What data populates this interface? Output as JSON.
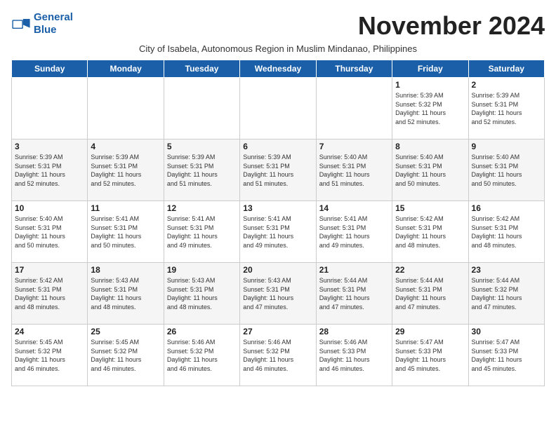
{
  "logo": {
    "line1": "General",
    "line2": "Blue"
  },
  "title": "November 2024",
  "subtitle": "City of Isabela, Autonomous Region in Muslim Mindanao, Philippines",
  "days_of_week": [
    "Sunday",
    "Monday",
    "Tuesday",
    "Wednesday",
    "Thursday",
    "Friday",
    "Saturday"
  ],
  "weeks": [
    [
      {
        "day": "",
        "detail": ""
      },
      {
        "day": "",
        "detail": ""
      },
      {
        "day": "",
        "detail": ""
      },
      {
        "day": "",
        "detail": ""
      },
      {
        "day": "",
        "detail": ""
      },
      {
        "day": "1",
        "detail": "Sunrise: 5:39 AM\nSunset: 5:32 PM\nDaylight: 11 hours\nand 52 minutes."
      },
      {
        "day": "2",
        "detail": "Sunrise: 5:39 AM\nSunset: 5:31 PM\nDaylight: 11 hours\nand 52 minutes."
      }
    ],
    [
      {
        "day": "3",
        "detail": "Sunrise: 5:39 AM\nSunset: 5:31 PM\nDaylight: 11 hours\nand 52 minutes."
      },
      {
        "day": "4",
        "detail": "Sunrise: 5:39 AM\nSunset: 5:31 PM\nDaylight: 11 hours\nand 52 minutes."
      },
      {
        "day": "5",
        "detail": "Sunrise: 5:39 AM\nSunset: 5:31 PM\nDaylight: 11 hours\nand 51 minutes."
      },
      {
        "day": "6",
        "detail": "Sunrise: 5:39 AM\nSunset: 5:31 PM\nDaylight: 11 hours\nand 51 minutes."
      },
      {
        "day": "7",
        "detail": "Sunrise: 5:40 AM\nSunset: 5:31 PM\nDaylight: 11 hours\nand 51 minutes."
      },
      {
        "day": "8",
        "detail": "Sunrise: 5:40 AM\nSunset: 5:31 PM\nDaylight: 11 hours\nand 50 minutes."
      },
      {
        "day": "9",
        "detail": "Sunrise: 5:40 AM\nSunset: 5:31 PM\nDaylight: 11 hours\nand 50 minutes."
      }
    ],
    [
      {
        "day": "10",
        "detail": "Sunrise: 5:40 AM\nSunset: 5:31 PM\nDaylight: 11 hours\nand 50 minutes."
      },
      {
        "day": "11",
        "detail": "Sunrise: 5:41 AM\nSunset: 5:31 PM\nDaylight: 11 hours\nand 50 minutes."
      },
      {
        "day": "12",
        "detail": "Sunrise: 5:41 AM\nSunset: 5:31 PM\nDaylight: 11 hours\nand 49 minutes."
      },
      {
        "day": "13",
        "detail": "Sunrise: 5:41 AM\nSunset: 5:31 PM\nDaylight: 11 hours\nand 49 minutes."
      },
      {
        "day": "14",
        "detail": "Sunrise: 5:41 AM\nSunset: 5:31 PM\nDaylight: 11 hours\nand 49 minutes."
      },
      {
        "day": "15",
        "detail": "Sunrise: 5:42 AM\nSunset: 5:31 PM\nDaylight: 11 hours\nand 48 minutes."
      },
      {
        "day": "16",
        "detail": "Sunrise: 5:42 AM\nSunset: 5:31 PM\nDaylight: 11 hours\nand 48 minutes."
      }
    ],
    [
      {
        "day": "17",
        "detail": "Sunrise: 5:42 AM\nSunset: 5:31 PM\nDaylight: 11 hours\nand 48 minutes."
      },
      {
        "day": "18",
        "detail": "Sunrise: 5:43 AM\nSunset: 5:31 PM\nDaylight: 11 hours\nand 48 minutes."
      },
      {
        "day": "19",
        "detail": "Sunrise: 5:43 AM\nSunset: 5:31 PM\nDaylight: 11 hours\nand 48 minutes."
      },
      {
        "day": "20",
        "detail": "Sunrise: 5:43 AM\nSunset: 5:31 PM\nDaylight: 11 hours\nand 47 minutes."
      },
      {
        "day": "21",
        "detail": "Sunrise: 5:44 AM\nSunset: 5:31 PM\nDaylight: 11 hours\nand 47 minutes."
      },
      {
        "day": "22",
        "detail": "Sunrise: 5:44 AM\nSunset: 5:31 PM\nDaylight: 11 hours\nand 47 minutes."
      },
      {
        "day": "23",
        "detail": "Sunrise: 5:44 AM\nSunset: 5:32 PM\nDaylight: 11 hours\nand 47 minutes."
      }
    ],
    [
      {
        "day": "24",
        "detail": "Sunrise: 5:45 AM\nSunset: 5:32 PM\nDaylight: 11 hours\nand 46 minutes."
      },
      {
        "day": "25",
        "detail": "Sunrise: 5:45 AM\nSunset: 5:32 PM\nDaylight: 11 hours\nand 46 minutes."
      },
      {
        "day": "26",
        "detail": "Sunrise: 5:46 AM\nSunset: 5:32 PM\nDaylight: 11 hours\nand 46 minutes."
      },
      {
        "day": "27",
        "detail": "Sunrise: 5:46 AM\nSunset: 5:32 PM\nDaylight: 11 hours\nand 46 minutes."
      },
      {
        "day": "28",
        "detail": "Sunrise: 5:46 AM\nSunset: 5:33 PM\nDaylight: 11 hours\nand 46 minutes."
      },
      {
        "day": "29",
        "detail": "Sunrise: 5:47 AM\nSunset: 5:33 PM\nDaylight: 11 hours\nand 45 minutes."
      },
      {
        "day": "30",
        "detail": "Sunrise: 5:47 AM\nSunset: 5:33 PM\nDaylight: 11 hours\nand 45 minutes."
      }
    ]
  ]
}
